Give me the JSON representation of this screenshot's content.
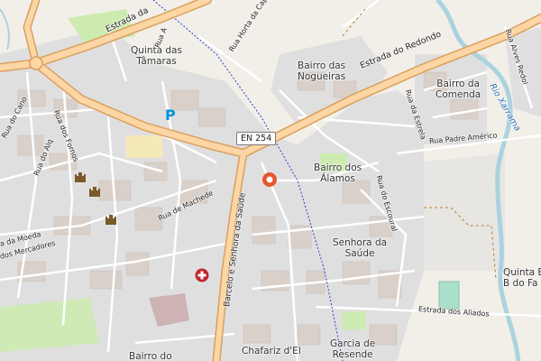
{
  "map": {
    "places": [
      {
        "id": "quinta-tamaras",
        "text": "Quinta das\nTâmaras"
      },
      {
        "id": "bairro-nogueiras",
        "text": "Bairro das\nNogueiras"
      },
      {
        "id": "bairro-comenda",
        "text": "Bairro da\nComenda"
      },
      {
        "id": "bairro-alamos",
        "text": "Bairro dos\nÁlamos"
      },
      {
        "id": "senhora-saude",
        "text": "Senhora da\nSaúde"
      },
      {
        "id": "quinta-bairro-fa",
        "text": "Quinta Ba\nB do Fa"
      },
      {
        "id": "chafariz",
        "text": "Chafariz d'El"
      },
      {
        "id": "garcia-resende",
        "text": "Garcia de\nResende"
      },
      {
        "id": "bairro-do",
        "text": "Bairro do"
      }
    ],
    "streets": [
      {
        "id": "estrada-redondo",
        "text": "Estrada do Redondo"
      },
      {
        "id": "estrada-da",
        "text": "Estrada da"
      },
      {
        "id": "rua-horta-capa",
        "text": "Rua Horta da Capa"
      },
      {
        "id": "rua-alves-redol",
        "text": "Rua Alves Redol"
      },
      {
        "id": "rua-estrela",
        "text": "Rua da Estrela"
      },
      {
        "id": "rua-padre-americo",
        "text": "Rua Padre Américo"
      },
      {
        "id": "rua-escoural",
        "text": "Rua do Escoural"
      },
      {
        "id": "rua-machede",
        "text": "Rua de Machede"
      },
      {
        "id": "rua-cano",
        "text": "Rua do Cano"
      },
      {
        "id": "rua-fornos",
        "text": "Rua dos Fornos"
      },
      {
        "id": "rua-alq",
        "text": "Rua do Alq"
      },
      {
        "id": "rua-moeda",
        "text": "a da Moeda"
      },
      {
        "id": "rua-mercadores",
        "text": "dos Mercadores"
      },
      {
        "id": "rua-a",
        "text": "Rua A"
      },
      {
        "id": "barcelo",
        "text": "Barcelo e Senhora da Saúde"
      },
      {
        "id": "estrada-aliados",
        "text": "Estrada dos Aliados"
      }
    ],
    "river": "Rio Xarrama",
    "road_ref": "EN 254",
    "colors": {
      "background": "#f2efe9",
      "residential": "#e0dfdf",
      "building": "#d9d0c9",
      "major_road": "#fcd6a4",
      "major_casing": "#d9a05f",
      "minor_road": "#ffffff",
      "water": "#aad3df",
      "park": "#cdebb0",
      "pitch": "#aae0cb",
      "historic": "#c4a0a0",
      "parking_blue": "#0092da",
      "pin": "#e4572e"
    },
    "icons": [
      "parking-icon",
      "castle-icon",
      "hospital-icon",
      "location-pin-icon"
    ]
  }
}
